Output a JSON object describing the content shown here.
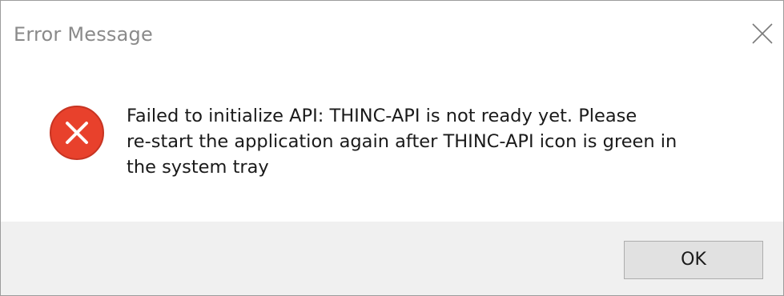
{
  "window": {
    "title": "Error Message"
  },
  "icons": {
    "close": "close-icon",
    "error": "error-icon",
    "error_color": "#e8412c"
  },
  "message": {
    "lines": [
      "Failed to initialize API: THINC-API is not ready yet. Please",
      "re-start the application again after THINC-API icon is green in",
      "the system tray"
    ]
  },
  "footer": {
    "ok_label": "OK"
  }
}
